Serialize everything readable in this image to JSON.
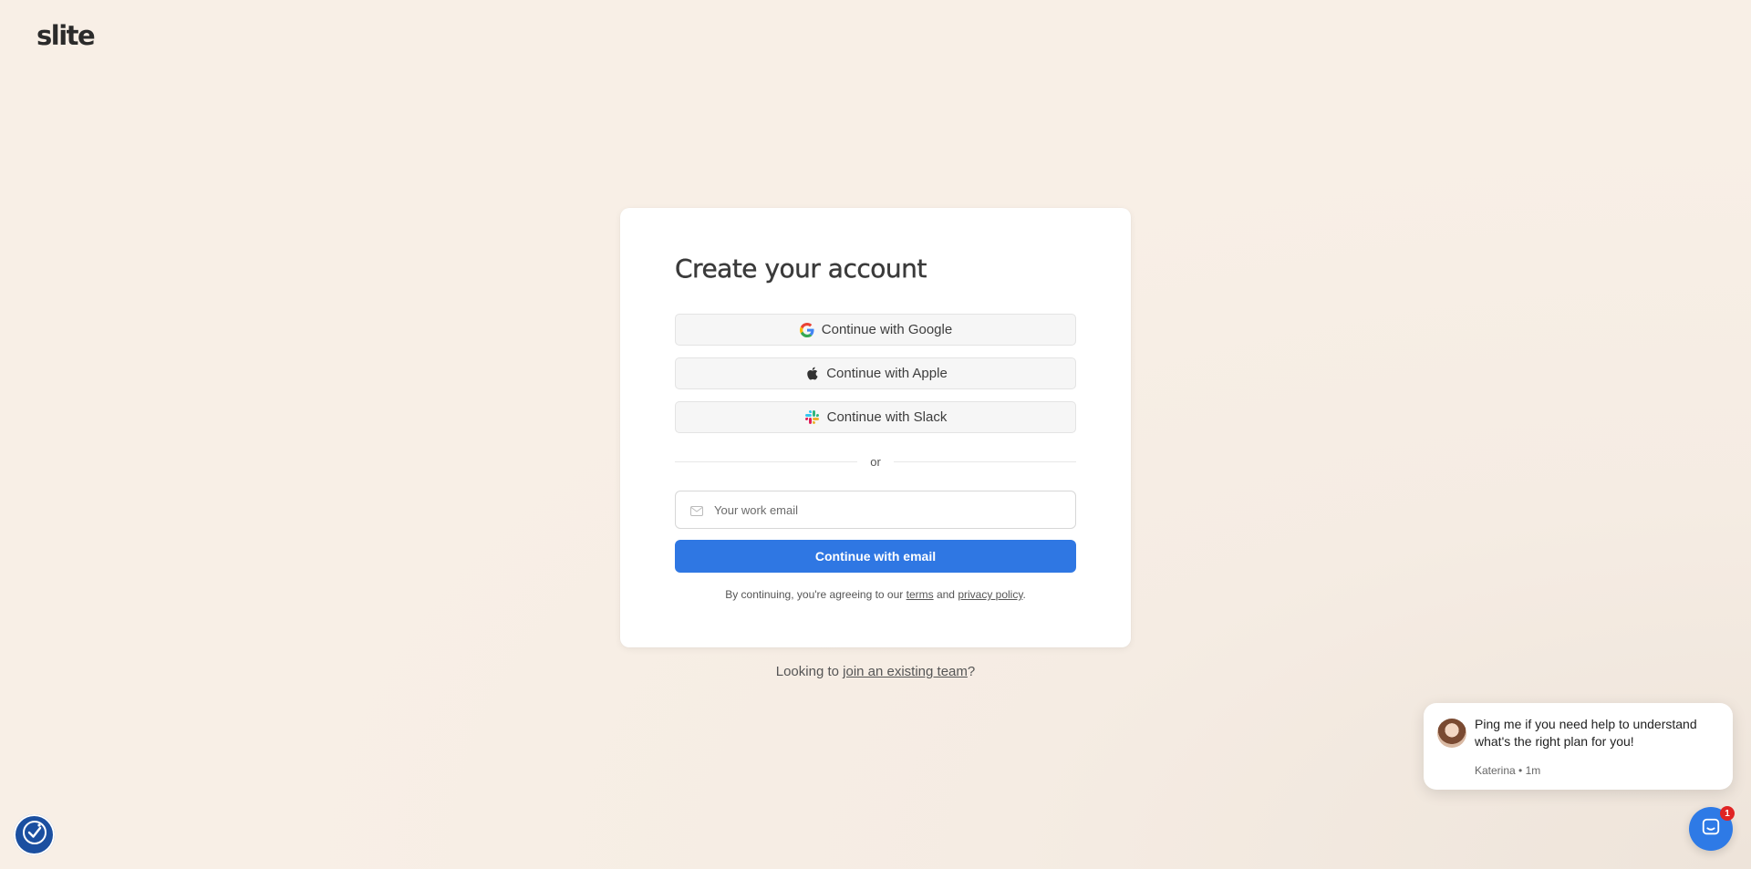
{
  "brand": {
    "logo": "slite"
  },
  "card": {
    "title": "Create your account",
    "sso": {
      "google_label": "Continue with Google",
      "apple_label": "Continue with Apple",
      "slack_label": "Continue with Slack"
    },
    "divider_text": "or",
    "email": {
      "value": "",
      "placeholder": "Your work email"
    },
    "submit_label": "Continue with email",
    "legal": {
      "prefix": "By continuing, you're agreeing to our ",
      "terms_link": "terms",
      "middle": " and ",
      "privacy_link": "privacy policy",
      "suffix": "."
    }
  },
  "footer": {
    "prefix": "Looking to ",
    "link": "join an existing team",
    "suffix": "?"
  },
  "chat": {
    "message": "Ping me if you need help to understand what's the right plan for you!",
    "meta": "Katerina • 1m",
    "unread_count": "1"
  },
  "colors": {
    "background": "#f8efe6",
    "primary": "#2f77e3",
    "a11y_button": "#1b4fa0",
    "badge": "#e02424"
  },
  "icons": {
    "google": "google-icon",
    "apple": "apple-icon",
    "slack": "slack-icon",
    "email": "mail-icon",
    "accessibility": "accessibility-icon",
    "chat": "chat-icon"
  }
}
